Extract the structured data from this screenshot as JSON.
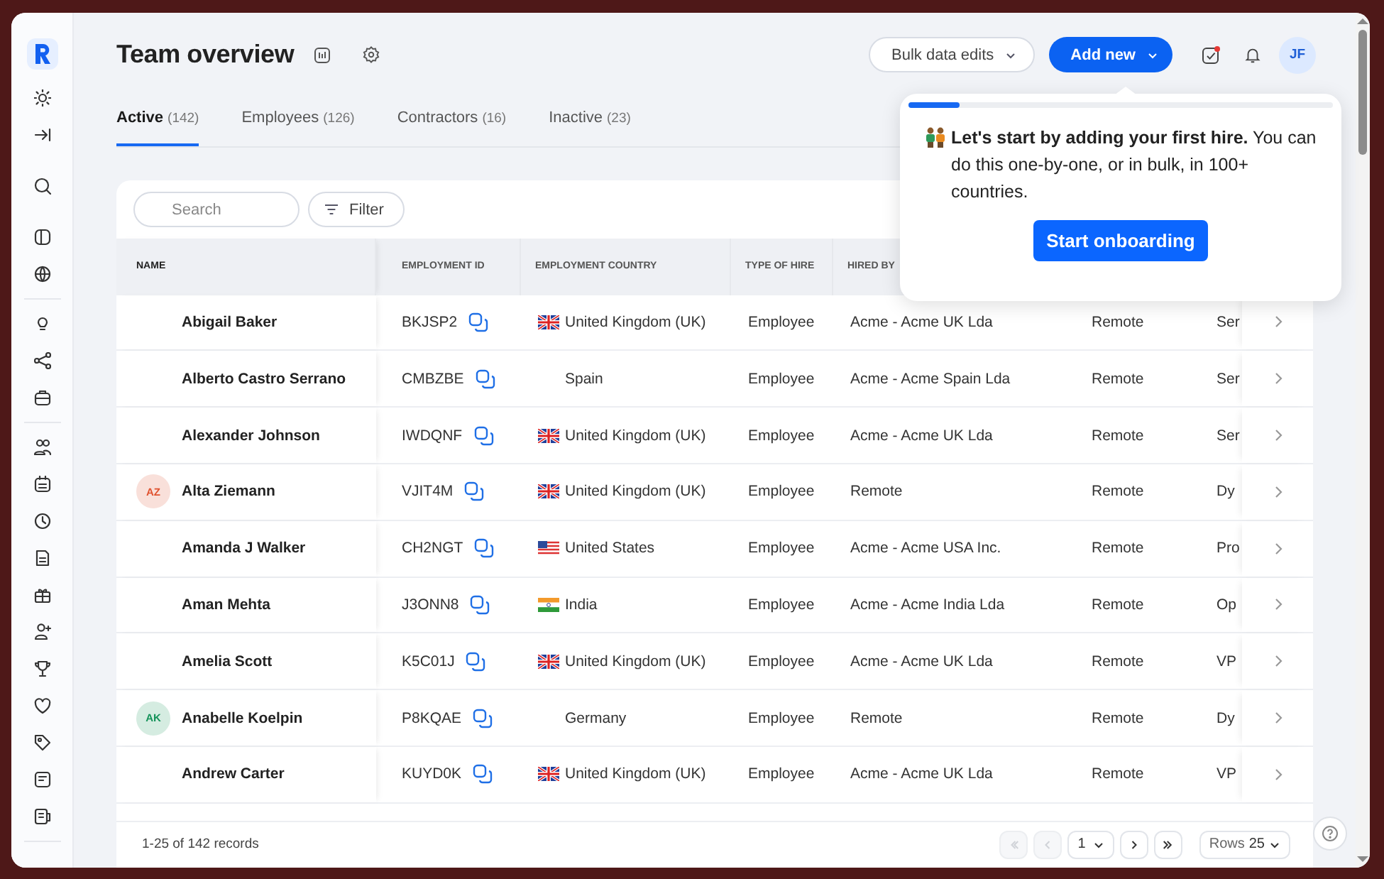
{
  "page": {
    "title": "Team overview"
  },
  "header_actions": {
    "bulk_button": "Bulk data edits",
    "add_button": "Add new",
    "user_initials": "JF"
  },
  "tabs": [
    {
      "label": "Active",
      "count": "(142)",
      "selected": true
    },
    {
      "label": "Employees",
      "count": "(126)",
      "selected": false
    },
    {
      "label": "Contractors",
      "count": "(16)",
      "selected": false
    },
    {
      "label": "Inactive",
      "count": "(23)",
      "selected": false
    }
  ],
  "toolbar": {
    "search": {
      "placeholder": "Search"
    },
    "filter_button": "Filter"
  },
  "table": {
    "columns": [
      "NAME",
      "EMPLOYMENT ID",
      "EMPLOYMENT COUNTRY",
      "TYPE OF HIRE",
      "HIRED BY"
    ],
    "rows": [
      {
        "name": "Abigail Baker",
        "id": "BKJSP2",
        "kind": "uk",
        "country": "United Kingdom (UK)",
        "type": "Employee",
        "hired_by": "Acme - Acme UK Lda",
        "column_6": "Remote",
        "column_7": "Ser"
      },
      {
        "name": "Alberto Castro Serrano",
        "id": "CMBZBE",
        "country": "Spain",
        "type": "Employee",
        "hired_by": "Acme - Acme Spain Lda",
        "column_6": "Remote",
        "column_7": "Ser"
      },
      {
        "name": "Alexander Johnson",
        "id": "IWDQNF",
        "kind": "uk",
        "country": "United Kingdom (UK)",
        "type": "Employee",
        "hired_by": "Acme - Acme UK Lda",
        "column_6": "Remote",
        "column_7": "Ser"
      },
      {
        "name": "Alta Ziemann",
        "avatar": {
          "initials": "AZ",
          "color": "#e0522f"
        },
        "id": "VJIT4M",
        "kind": "uk",
        "country": "United Kingdom (UK)",
        "type": "Employee",
        "hired_by": "Remote",
        "column_6": "Remote",
        "column_7": "Dy"
      },
      {
        "name": "Amanda J Walker",
        "id": "CH2NGT",
        "kind": "us",
        "country": "United States",
        "type": "Employee",
        "hired_by": "Acme - Acme USA Inc.",
        "column_6": "Remote",
        "column_7": "Pro"
      },
      {
        "name": "Aman Mehta",
        "id": "J3ONN8",
        "kind": "in",
        "country": "India",
        "type": "Employee",
        "hired_by": "Acme - Acme India Lda",
        "column_6": "Remote",
        "column_7": "Op"
      },
      {
        "name": "Amelia Scott",
        "id": "K5C01J",
        "kind": "uk",
        "country": "United Kingdom (UK)",
        "type": "Employee",
        "hired_by": "Acme - Acme UK Lda",
        "column_6": "Remote",
        "column_7": "VP"
      },
      {
        "name": "Anabelle Koelpin",
        "avatar": {
          "initials": "AK",
          "color": "#15935a"
        },
        "id": "P8KQAE",
        "country": "Germany",
        "type": "Employee",
        "hired_by": "Remote",
        "column_6": "Remote",
        "column_7": "Dy"
      },
      {
        "name": "Andrew Carter",
        "id": "KUYD0K",
        "kind": "uk",
        "country": "United Kingdom (UK)",
        "type": "Employee",
        "hired_by": "Acme - Acme UK Lda",
        "column_6": "Remote",
        "column_7": "VP"
      }
    ]
  },
  "footer": {
    "records": "1-25 of 142 records",
    "page": "1",
    "rows_label": "Rows",
    "rows_value": "25",
    "nav_buttons": [
      {
        "kind": "first",
        "disabled": true
      },
      {
        "kind": "prev",
        "disabled": true
      },
      {
        "kind": "next",
        "disabled": false
      },
      {
        "kind": "last",
        "disabled": false
      }
    ]
  },
  "popover": {
    "level": 0.12,
    "text": "**Let's start by adding your first hire.** You can do this one-by-one, or in bulk, in 100+ countries.",
    "button": "Start onboarding"
  }
}
